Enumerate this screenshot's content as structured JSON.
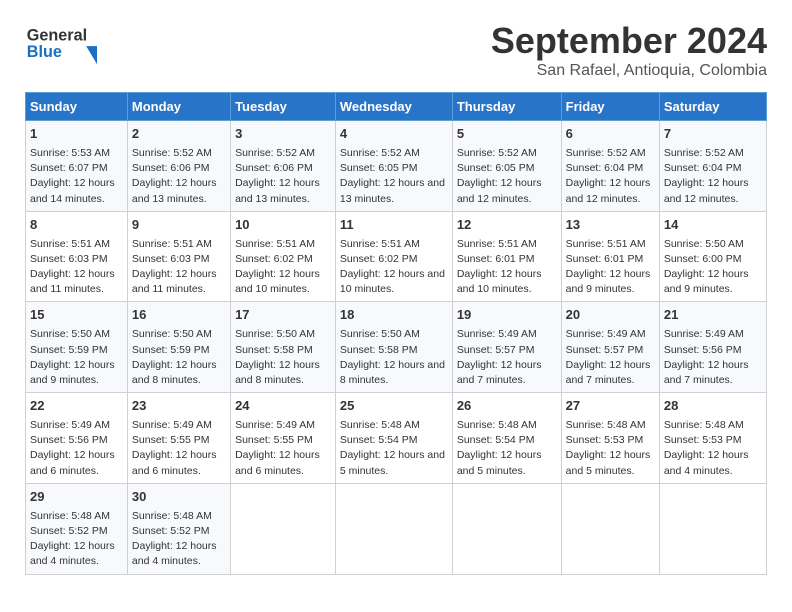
{
  "header": {
    "logo_general": "General",
    "logo_blue": "Blue",
    "title": "September 2024",
    "subtitle": "San Rafael, Antioquia, Colombia"
  },
  "days_of_week": [
    "Sunday",
    "Monday",
    "Tuesday",
    "Wednesday",
    "Thursday",
    "Friday",
    "Saturday"
  ],
  "weeks": [
    [
      {
        "day": "1",
        "sunrise": "Sunrise: 5:53 AM",
        "sunset": "Sunset: 6:07 PM",
        "daylight": "Daylight: 12 hours and 14 minutes."
      },
      {
        "day": "2",
        "sunrise": "Sunrise: 5:52 AM",
        "sunset": "Sunset: 6:06 PM",
        "daylight": "Daylight: 12 hours and 13 minutes."
      },
      {
        "day": "3",
        "sunrise": "Sunrise: 5:52 AM",
        "sunset": "Sunset: 6:06 PM",
        "daylight": "Daylight: 12 hours and 13 minutes."
      },
      {
        "day": "4",
        "sunrise": "Sunrise: 5:52 AM",
        "sunset": "Sunset: 6:05 PM",
        "daylight": "Daylight: 12 hours and 13 minutes."
      },
      {
        "day": "5",
        "sunrise": "Sunrise: 5:52 AM",
        "sunset": "Sunset: 6:05 PM",
        "daylight": "Daylight: 12 hours and 12 minutes."
      },
      {
        "day": "6",
        "sunrise": "Sunrise: 5:52 AM",
        "sunset": "Sunset: 6:04 PM",
        "daylight": "Daylight: 12 hours and 12 minutes."
      },
      {
        "day": "7",
        "sunrise": "Sunrise: 5:52 AM",
        "sunset": "Sunset: 6:04 PM",
        "daylight": "Daylight: 12 hours and 12 minutes."
      }
    ],
    [
      {
        "day": "8",
        "sunrise": "Sunrise: 5:51 AM",
        "sunset": "Sunset: 6:03 PM",
        "daylight": "Daylight: 12 hours and 11 minutes."
      },
      {
        "day": "9",
        "sunrise": "Sunrise: 5:51 AM",
        "sunset": "Sunset: 6:03 PM",
        "daylight": "Daylight: 12 hours and 11 minutes."
      },
      {
        "day": "10",
        "sunrise": "Sunrise: 5:51 AM",
        "sunset": "Sunset: 6:02 PM",
        "daylight": "Daylight: 12 hours and 10 minutes."
      },
      {
        "day": "11",
        "sunrise": "Sunrise: 5:51 AM",
        "sunset": "Sunset: 6:02 PM",
        "daylight": "Daylight: 12 hours and 10 minutes."
      },
      {
        "day": "12",
        "sunrise": "Sunrise: 5:51 AM",
        "sunset": "Sunset: 6:01 PM",
        "daylight": "Daylight: 12 hours and 10 minutes."
      },
      {
        "day": "13",
        "sunrise": "Sunrise: 5:51 AM",
        "sunset": "Sunset: 6:01 PM",
        "daylight": "Daylight: 12 hours and 9 minutes."
      },
      {
        "day": "14",
        "sunrise": "Sunrise: 5:50 AM",
        "sunset": "Sunset: 6:00 PM",
        "daylight": "Daylight: 12 hours and 9 minutes."
      }
    ],
    [
      {
        "day": "15",
        "sunrise": "Sunrise: 5:50 AM",
        "sunset": "Sunset: 5:59 PM",
        "daylight": "Daylight: 12 hours and 9 minutes."
      },
      {
        "day": "16",
        "sunrise": "Sunrise: 5:50 AM",
        "sunset": "Sunset: 5:59 PM",
        "daylight": "Daylight: 12 hours and 8 minutes."
      },
      {
        "day": "17",
        "sunrise": "Sunrise: 5:50 AM",
        "sunset": "Sunset: 5:58 PM",
        "daylight": "Daylight: 12 hours and 8 minutes."
      },
      {
        "day": "18",
        "sunrise": "Sunrise: 5:50 AM",
        "sunset": "Sunset: 5:58 PM",
        "daylight": "Daylight: 12 hours and 8 minutes."
      },
      {
        "day": "19",
        "sunrise": "Sunrise: 5:49 AM",
        "sunset": "Sunset: 5:57 PM",
        "daylight": "Daylight: 12 hours and 7 minutes."
      },
      {
        "day": "20",
        "sunrise": "Sunrise: 5:49 AM",
        "sunset": "Sunset: 5:57 PM",
        "daylight": "Daylight: 12 hours and 7 minutes."
      },
      {
        "day": "21",
        "sunrise": "Sunrise: 5:49 AM",
        "sunset": "Sunset: 5:56 PM",
        "daylight": "Daylight: 12 hours and 7 minutes."
      }
    ],
    [
      {
        "day": "22",
        "sunrise": "Sunrise: 5:49 AM",
        "sunset": "Sunset: 5:56 PM",
        "daylight": "Daylight: 12 hours and 6 minutes."
      },
      {
        "day": "23",
        "sunrise": "Sunrise: 5:49 AM",
        "sunset": "Sunset: 5:55 PM",
        "daylight": "Daylight: 12 hours and 6 minutes."
      },
      {
        "day": "24",
        "sunrise": "Sunrise: 5:49 AM",
        "sunset": "Sunset: 5:55 PM",
        "daylight": "Daylight: 12 hours and 6 minutes."
      },
      {
        "day": "25",
        "sunrise": "Sunrise: 5:48 AM",
        "sunset": "Sunset: 5:54 PM",
        "daylight": "Daylight: 12 hours and 5 minutes."
      },
      {
        "day": "26",
        "sunrise": "Sunrise: 5:48 AM",
        "sunset": "Sunset: 5:54 PM",
        "daylight": "Daylight: 12 hours and 5 minutes."
      },
      {
        "day": "27",
        "sunrise": "Sunrise: 5:48 AM",
        "sunset": "Sunset: 5:53 PM",
        "daylight": "Daylight: 12 hours and 5 minutes."
      },
      {
        "day": "28",
        "sunrise": "Sunrise: 5:48 AM",
        "sunset": "Sunset: 5:53 PM",
        "daylight": "Daylight: 12 hours and 4 minutes."
      }
    ],
    [
      {
        "day": "29",
        "sunrise": "Sunrise: 5:48 AM",
        "sunset": "Sunset: 5:52 PM",
        "daylight": "Daylight: 12 hours and 4 minutes."
      },
      {
        "day": "30",
        "sunrise": "Sunrise: 5:48 AM",
        "sunset": "Sunset: 5:52 PM",
        "daylight": "Daylight: 12 hours and 4 minutes."
      },
      null,
      null,
      null,
      null,
      null
    ]
  ]
}
